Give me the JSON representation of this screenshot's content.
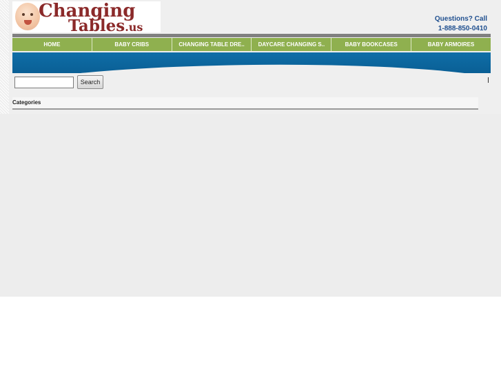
{
  "logo": {
    "line1": "Changing",
    "line2": "Tables",
    "tld": ".us"
  },
  "contact": {
    "label": "Questions? Call",
    "phone": "1-888-850-0410"
  },
  "nav": {
    "items": [
      {
        "label": "HOME"
      },
      {
        "label": "BABY CRIBS"
      },
      {
        "label": "CHANGING TABLE DRE.."
      },
      {
        "label": "DAYCARE CHANGING S.."
      },
      {
        "label": "BABY BOOKCASES"
      },
      {
        "label": "BABY ARMOIRES"
      }
    ]
  },
  "search": {
    "value": "",
    "button_label": "Search"
  },
  "sidebar": {
    "categories_heading": "Categories"
  },
  "colors": {
    "nav_green": "#8fb04f",
    "banner_blue": "#0a5f95",
    "contact_blue": "#1f4f8f",
    "logo_red": "#8b2a2a"
  }
}
